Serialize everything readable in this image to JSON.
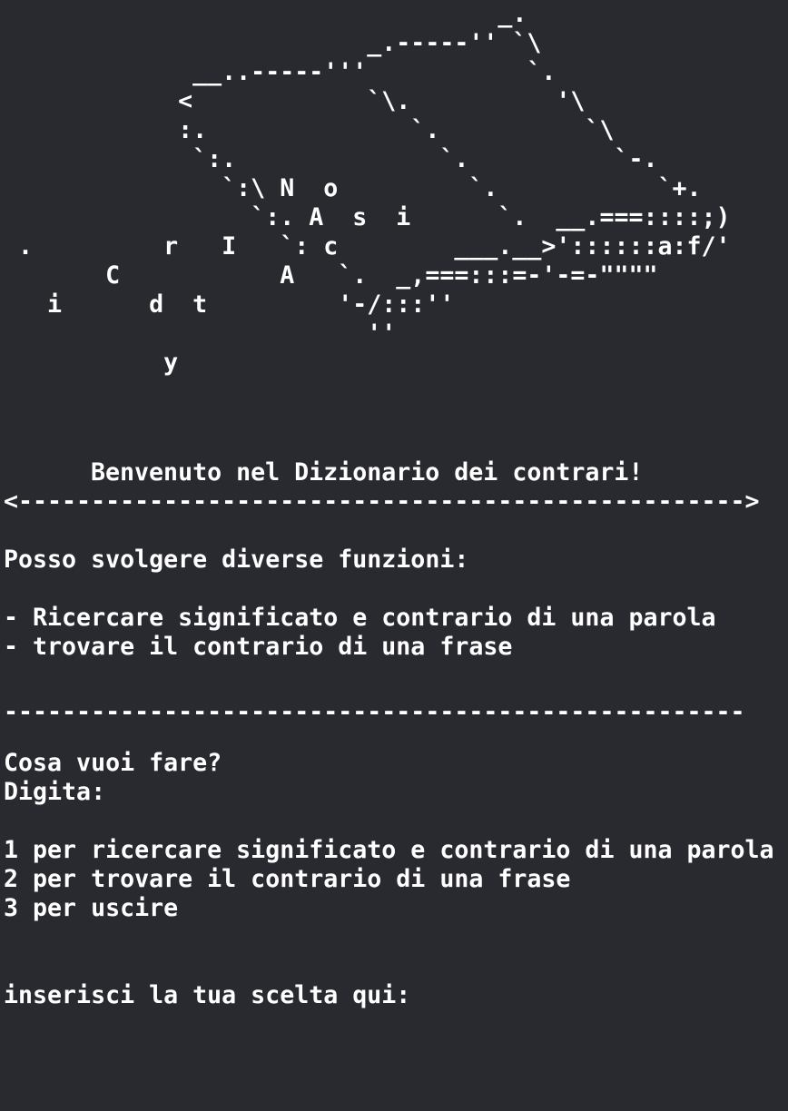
{
  "ascii_art": "                                  _.\n                         _.-----'' `\\\n             __..-----'''           `.\n            <            `\\.          '\\\n            :.              `.          `\\\n             `:.              `.          `-.\n               `:\\ N  o         `.           `+.\n                 `:. A  s  i      `.  __.===::::;)\n .         r   I   `: c        ___.__>'::::::a:f/'\n       C           A   `.  _,===:::=-'-=-\"\"\"\"\n   i      d  t         '-/:::''\n                         ''\n           y",
  "welcome": "Benvenuto nel Dizionario dei contrari!",
  "arrow_divider": "<-------------------------------------------------->",
  "functions_intro": "Posso svolgere diverse funzioni:",
  "functions": [
    "- Ricercare significato e contrario di una parola",
    "- trovare il contrario di una frase"
  ],
  "dash_divider": "---------------------------------------------------",
  "question": "Cosa vuoi fare?",
  "instruction": "Digita:",
  "options": [
    "1 per ricercare significato e contrario di una parola",
    "2 per trovare il contrario di una frase",
    "3 per uscire"
  ],
  "prompt": "inserisci la tua scelta qui:"
}
